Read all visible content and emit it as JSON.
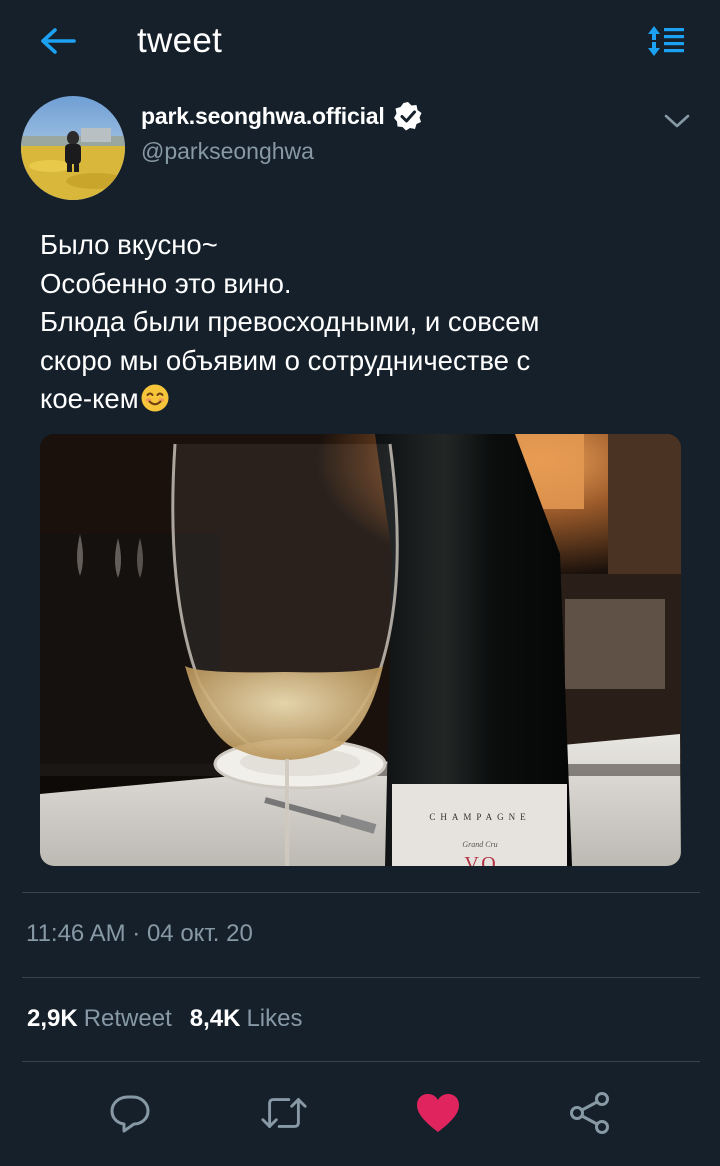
{
  "header": {
    "title": "tweet",
    "back_icon": "arrow-left-icon",
    "sort_icon": "sort-icon",
    "accent_color": "#1da1f2"
  },
  "author": {
    "display_name": "park.seonghwa.official",
    "handle": "@parkseonghwa",
    "verified": true
  },
  "tweet": {
    "lines": [
      "Было вкусно~",
      "Особенно это вино.",
      "Блюда были превосходными, и совсем",
      "скоро мы объявим о сотрудничестве с",
      "кое-кем"
    ],
    "emoji": "smiling-face-icon"
  },
  "media": {
    "bottle_label": "CHAMPAGNE",
    "bottle_sublabel": "Grand Cru",
    "bottle_mark": "V.O"
  },
  "timestamp": "11:46 AM · 04 окт. 20",
  "stats": {
    "retweets": "2,9K",
    "retweets_label": "Retweet",
    "likes": "8,4K",
    "likes_label": "Likes"
  },
  "actions": {
    "reply_icon": "reply-icon",
    "retweet_icon": "retweet-icon",
    "like_icon": "heart-icon",
    "share_icon": "share-icon",
    "like_color": "#e0245e"
  },
  "colors": {
    "background": "#15202b",
    "secondary_text": "#8899a6",
    "divider": "#38444d"
  }
}
